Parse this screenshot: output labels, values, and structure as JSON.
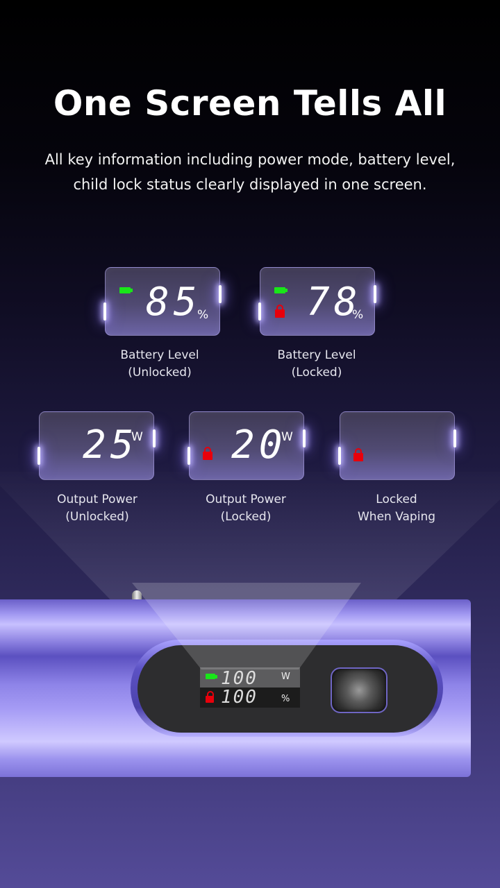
{
  "header": {
    "title": "One Screen Tells All",
    "subtitle_line1": "All key information including power mode, battery level,",
    "subtitle_line2": "child lock status clearly displayed in one screen."
  },
  "colors": {
    "battery_green": "#19e619",
    "lock_red": "#e8000b",
    "device_purple": "#8e84e8"
  },
  "screens": [
    {
      "value": "85",
      "unit": "%",
      "battery_icon": true,
      "lock_icon": false,
      "label_line1": "Battery Level",
      "label_line2": "(Unlocked)"
    },
    {
      "value": "78",
      "unit": "%",
      "battery_icon": true,
      "lock_icon": true,
      "label_line1": "Battery Level",
      "label_line2": "(Locked)"
    },
    {
      "value": "25",
      "unit": "W",
      "battery_icon": false,
      "lock_icon": false,
      "label_line1": "Output Power",
      "label_line2": "(Unlocked)"
    },
    {
      "value": "20",
      "unit": "W",
      "battery_icon": false,
      "lock_icon": true,
      "label_line1": "Output Power",
      "label_line2": "(Locked)"
    },
    {
      "value": "",
      "unit": "",
      "battery_icon": false,
      "lock_icon": true,
      "label_line1": "Locked",
      "label_line2": "When Vaping"
    }
  ],
  "device_display": {
    "power_value": "100",
    "power_unit": "W",
    "battery_value": "100",
    "battery_unit": "%",
    "icons": [
      "battery-icon",
      "lock-icon"
    ]
  }
}
